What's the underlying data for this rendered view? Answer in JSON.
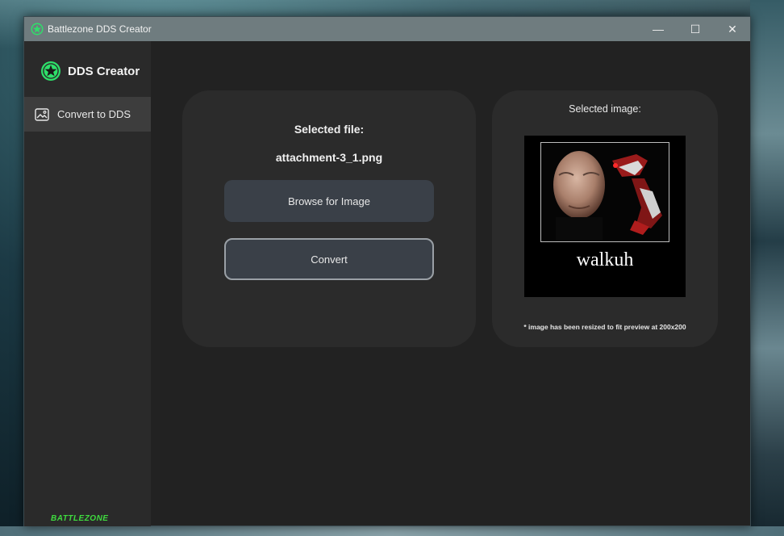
{
  "window": {
    "title": "Battlezone DDS Creator",
    "controls": {
      "minimize": "—",
      "maximize": "☐",
      "close": "✕"
    }
  },
  "sidebar": {
    "brand": "DDS Creator",
    "items": [
      {
        "label": "Convert to DDS",
        "icon": "image-icon",
        "active": true
      }
    ],
    "footer_logo": "BATTLEZONE"
  },
  "main": {
    "selected_file_label": "Selected file:",
    "selected_file_name": "attachment-3_1.png",
    "browse_button": "Browse for Image",
    "convert_button": "Convert"
  },
  "preview": {
    "title": "Selected image:",
    "image_caption": "walkuh",
    "note": "* image has been resized to fit preview at 200x200"
  },
  "colors": {
    "accent": "#2ee06a",
    "titlebar": "#6f7c7f",
    "background": "#222222",
    "sidebar": "#2a2a2a",
    "card": "#2b2b2b",
    "button": "#3a4048"
  }
}
